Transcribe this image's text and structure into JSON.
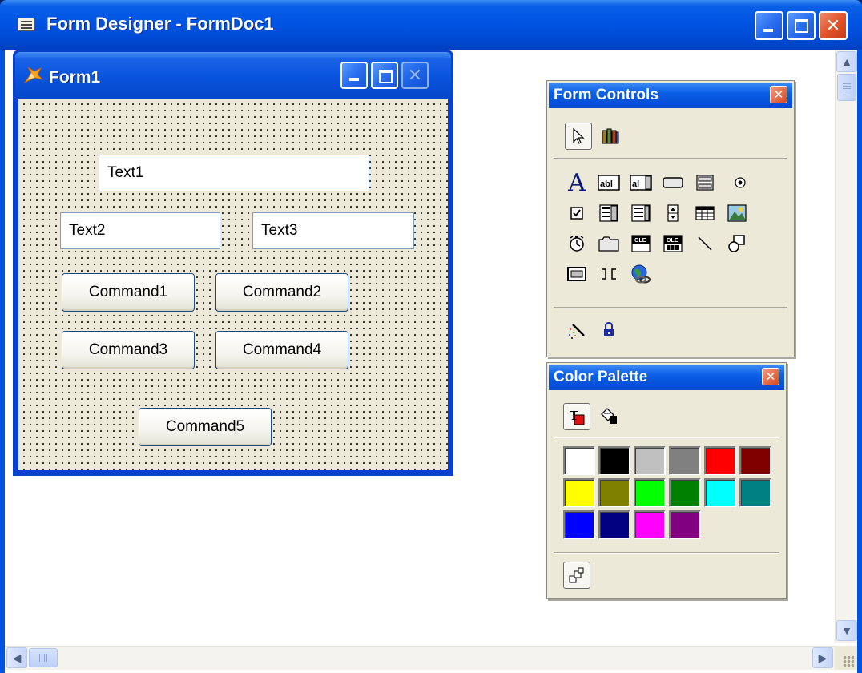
{
  "app": {
    "title": "Form Designer - FormDoc1"
  },
  "form": {
    "title": "Form1",
    "textboxes": [
      {
        "name": "Text1",
        "value": "Text1"
      },
      {
        "name": "Text2",
        "value": "Text2"
      },
      {
        "name": "Text3",
        "value": "Text3"
      }
    ],
    "commands": [
      {
        "label": "Command1"
      },
      {
        "label": "Command2"
      },
      {
        "label": "Command3"
      },
      {
        "label": "Command4"
      },
      {
        "label": "Command5"
      }
    ]
  },
  "form_controls": {
    "title": "Form Controls",
    "close_glyph": "✕",
    "top_tools": [
      "pointer-tool",
      "builder-tool"
    ],
    "tools": [
      "label-tool",
      "textbox-tool",
      "editbox-tool",
      "command-button-tool",
      "command-group-tool",
      "option-group-tool",
      "checkbox-tool",
      "combobox-tool",
      "listbox-tool",
      "spinner-tool",
      "grid-tool",
      "image-tool",
      "timer-tool",
      "pageframe-tool",
      "activex-control-tool",
      "activex-bound-control-tool",
      "line-tool",
      "shape-tool",
      "container-tool",
      "separator-tool",
      "hyperlink-tool"
    ],
    "bottom_tools": [
      "builder-lock-tool",
      "button-lock-tool"
    ]
  },
  "color_palette": {
    "title": "Color Palette",
    "close_glyph": "✕",
    "modes": [
      "foreground-color-mode",
      "background-color-mode"
    ],
    "swatches": [
      "#ffffff",
      "#000000",
      "#c0c0c0",
      "#808080",
      "#ff0000",
      "#800000",
      "#ffff00",
      "#808000",
      "#00ff00",
      "#008000",
      "#00ffff",
      "#008080",
      "#0000ff",
      "#000080",
      "#ff00ff",
      "#800080"
    ],
    "bottom_tool": "other-colors-button"
  },
  "scrollbars": {
    "up": "▲",
    "down": "▼",
    "left": "◀",
    "right": "▶"
  }
}
